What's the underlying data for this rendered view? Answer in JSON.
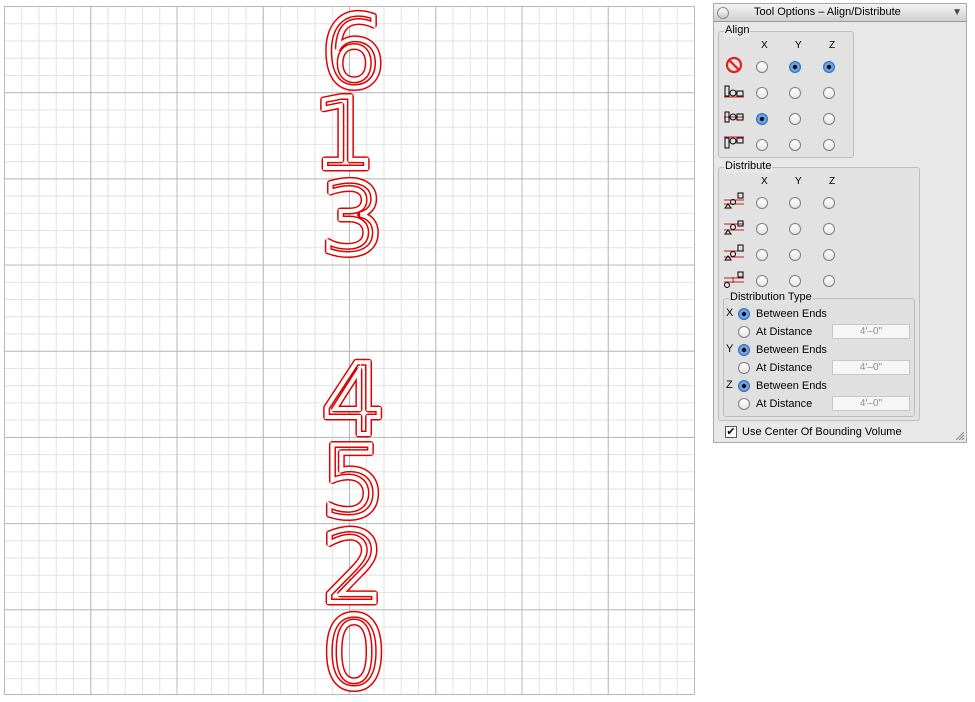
{
  "canvas": {
    "digits": [
      "6",
      "1",
      "3",
      "4",
      "5",
      "2",
      "0"
    ],
    "stroke_color": "#e00000"
  },
  "palette": {
    "title": "Tool Options – Align/Distribute",
    "collapse_glyph": "▼",
    "align": {
      "label": "Align",
      "columns": [
        "X",
        "Y",
        "Z"
      ],
      "rows": [
        {
          "icon": "no-align-icon",
          "selected": [
            false,
            true,
            true
          ]
        },
        {
          "icon": "align-min-icon",
          "selected": [
            false,
            false,
            false
          ]
        },
        {
          "icon": "align-center-icon",
          "selected": [
            true,
            false,
            false
          ]
        },
        {
          "icon": "align-max-icon",
          "selected": [
            false,
            false,
            false
          ]
        }
      ]
    },
    "distribute": {
      "label": "Distribute",
      "columns": [
        "X",
        "Y",
        "Z"
      ],
      "rows": [
        {
          "icon": "distribute-top-icon"
        },
        {
          "icon": "distribute-center-icon"
        },
        {
          "icon": "distribute-bottom-icon"
        },
        {
          "icon": "distribute-gap-icon"
        }
      ]
    },
    "distribution_type": {
      "label": "Distribution Type",
      "axes": [
        {
          "axis": "X",
          "between_label": "Between Ends",
          "distance_label": "At Distance",
          "distance_value": "4'–0\"",
          "between_selected": true
        },
        {
          "axis": "Y",
          "between_label": "Between Ends",
          "distance_label": "At Distance",
          "distance_value": "4'–0\"",
          "between_selected": true
        },
        {
          "axis": "Z",
          "between_label": "Between Ends",
          "distance_label": "At Distance",
          "distance_value": "4'–0\"",
          "between_selected": true
        }
      ]
    },
    "use_center": {
      "label": "Use Center Of Bounding Volume",
      "checked": true,
      "check_glyph": "✔"
    },
    "accent_color": "#3b7ed8"
  }
}
